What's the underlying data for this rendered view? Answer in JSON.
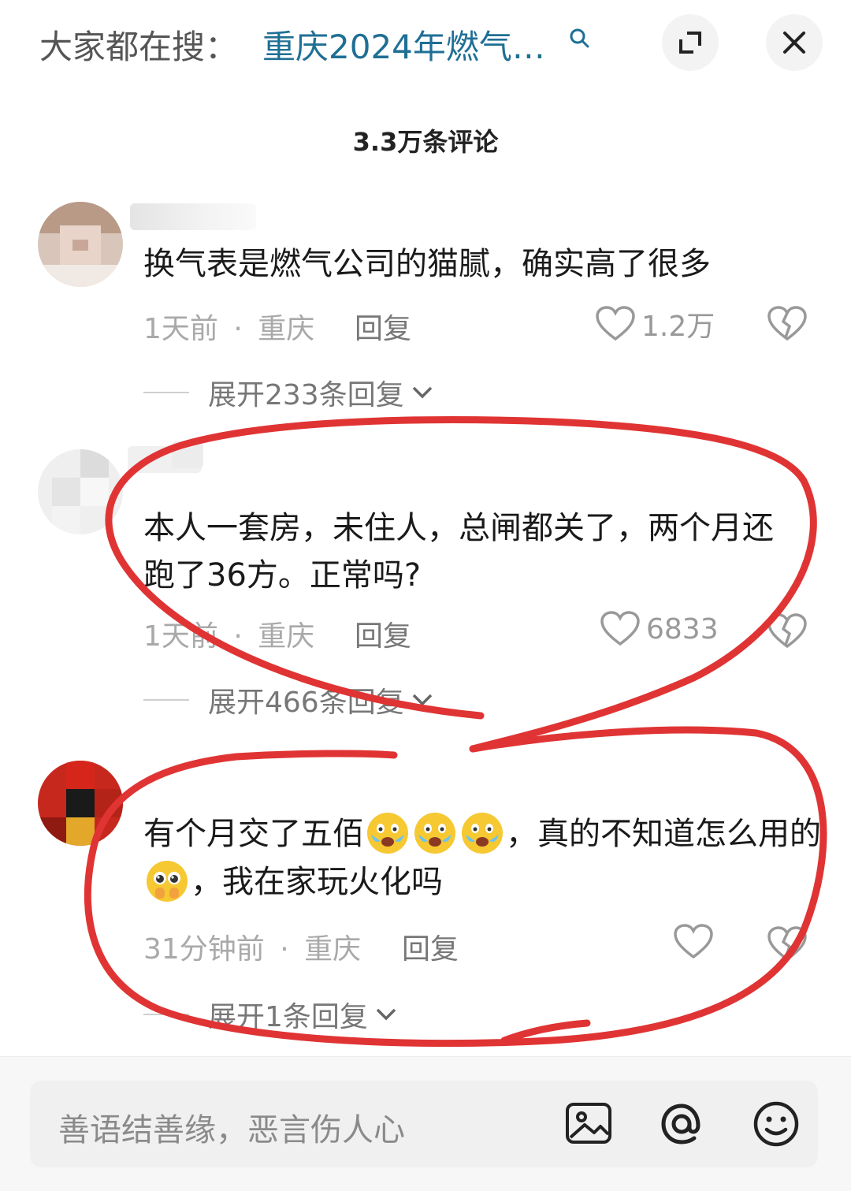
{
  "search": {
    "prefix": "大家都在搜：",
    "query": "重庆2024年燃气…"
  },
  "header": {
    "count_title": "3.3万条评论"
  },
  "comments": [
    {
      "text": "换气表是燃气公司的猫腻，确实高了很多",
      "time": "1天前",
      "location": "重庆",
      "reply_label": "回复",
      "likes": "1.2万",
      "expand_label": "展开233条回复"
    },
    {
      "text": "本人一套房，未住人，总闸都关了，两个月还跑了36方。正常吗?",
      "time": "1天前",
      "location": "重庆",
      "reply_label": "回复",
      "likes": "6833",
      "expand_label": "展开466条回复"
    },
    {
      "text_part1": "有个月交了五佰",
      "text_part2": "，真的不知道怎么用的",
      "text_part3": "，我在家玩火化吗",
      "time": "31分钟前",
      "location": "重庆",
      "reply_label": "回复",
      "likes": "",
      "expand_label": "展开1条回复"
    }
  ],
  "meta_separator": "·",
  "input": {
    "placeholder": "善语结善缘，恶言伤人心"
  },
  "colors": {
    "query_link": "#1f6f95",
    "ink_red": "#e03434",
    "meta_gray": "#a9a9a9"
  },
  "icons": [
    "search-icon",
    "expand-icon",
    "close-icon",
    "heart-icon",
    "broken-heart-icon",
    "chevron-down-icon",
    "image-icon",
    "at-icon",
    "smiley-icon",
    "crying-emoji",
    "pleading-emoji"
  ]
}
